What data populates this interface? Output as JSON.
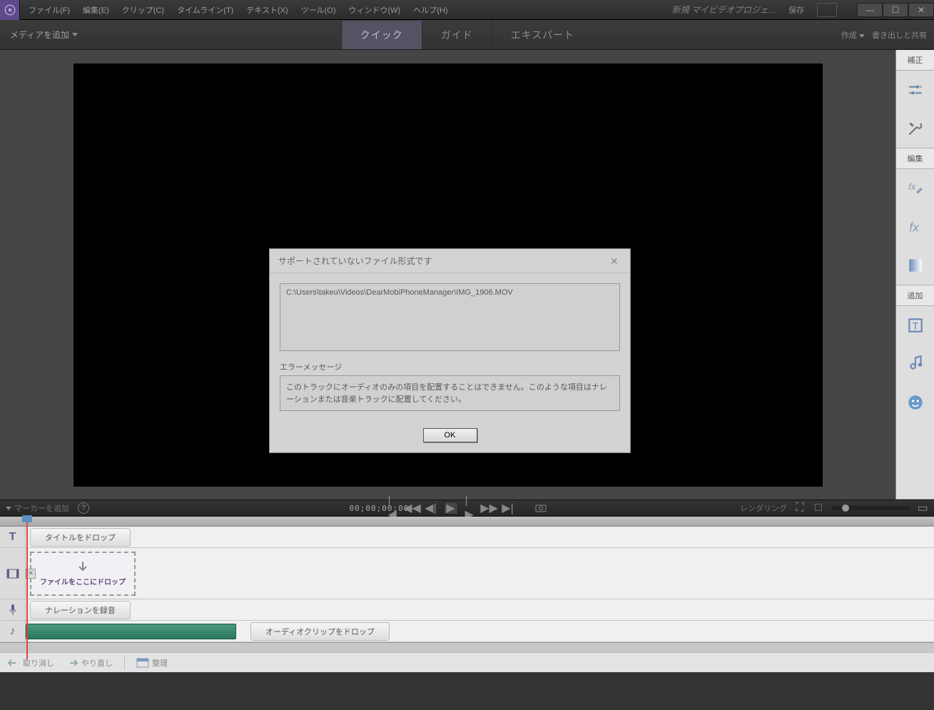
{
  "menu": {
    "file": "ファイル(F)",
    "edit": "編集(E)",
    "clip": "クリップ(C)",
    "timeline": "タイムライン(T)",
    "text": "テキスト(X)",
    "tools": "ツール(O)",
    "window": "ウィンドウ(W)",
    "help": "ヘルプ(H)"
  },
  "titlebar": {
    "project": "新規 マイビデオプロジェ...",
    "save": "保存"
  },
  "modebar": {
    "add_media": "メディアを追加",
    "quick": "クイック",
    "guide": "ガイド",
    "expert": "エキスパート",
    "create": "作成",
    "export": "書き出しと共有"
  },
  "sidebar": {
    "adjust": "補正",
    "edit": "編集",
    "add": "追加"
  },
  "transport": {
    "marker": "マーカーを追加",
    "timecode": "00;00;00;00",
    "render": "レンダリング"
  },
  "timeline": {
    "title_drop": "タイトルをドロップ",
    "file_drop": "ファイルをここにドロップ",
    "narration": "ナレーションを録音",
    "audio_drop": "オーディオクリップをドロップ"
  },
  "bottom": {
    "undo": "取り消し",
    "redo": "やり直し",
    "organize": "整理"
  },
  "dialog": {
    "title": "サポートされていないファイル形式です",
    "path": "C:\\Users\\takeu\\Videos\\DearMobiPhoneManager\\IMG_1906.MOV",
    "error_label": "エラーメッセージ",
    "error_text": "このトラックにオーディオのみの項目を配置することはできません。このような項目はナレーションまたは音楽トラックに配置してください。",
    "ok": "OK"
  }
}
